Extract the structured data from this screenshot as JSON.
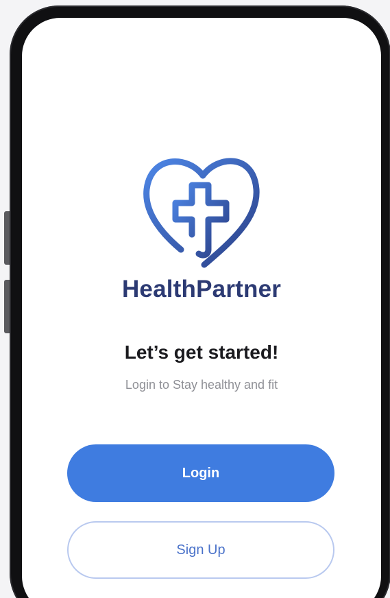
{
  "app": {
    "brand_name": "HealthPartner",
    "logo_icon": "heart-cross-icon"
  },
  "welcome": {
    "title": "Let’s get started!",
    "subtitle": "Login to Stay healthy and fit"
  },
  "actions": {
    "login_label": "Login",
    "signup_label": "Sign Up"
  },
  "colors": {
    "primary": "#3f7ce0",
    "brand_text": "#2c3a73",
    "subtitle_text": "#8f9096",
    "signup_border": "#b9c9ef"
  }
}
